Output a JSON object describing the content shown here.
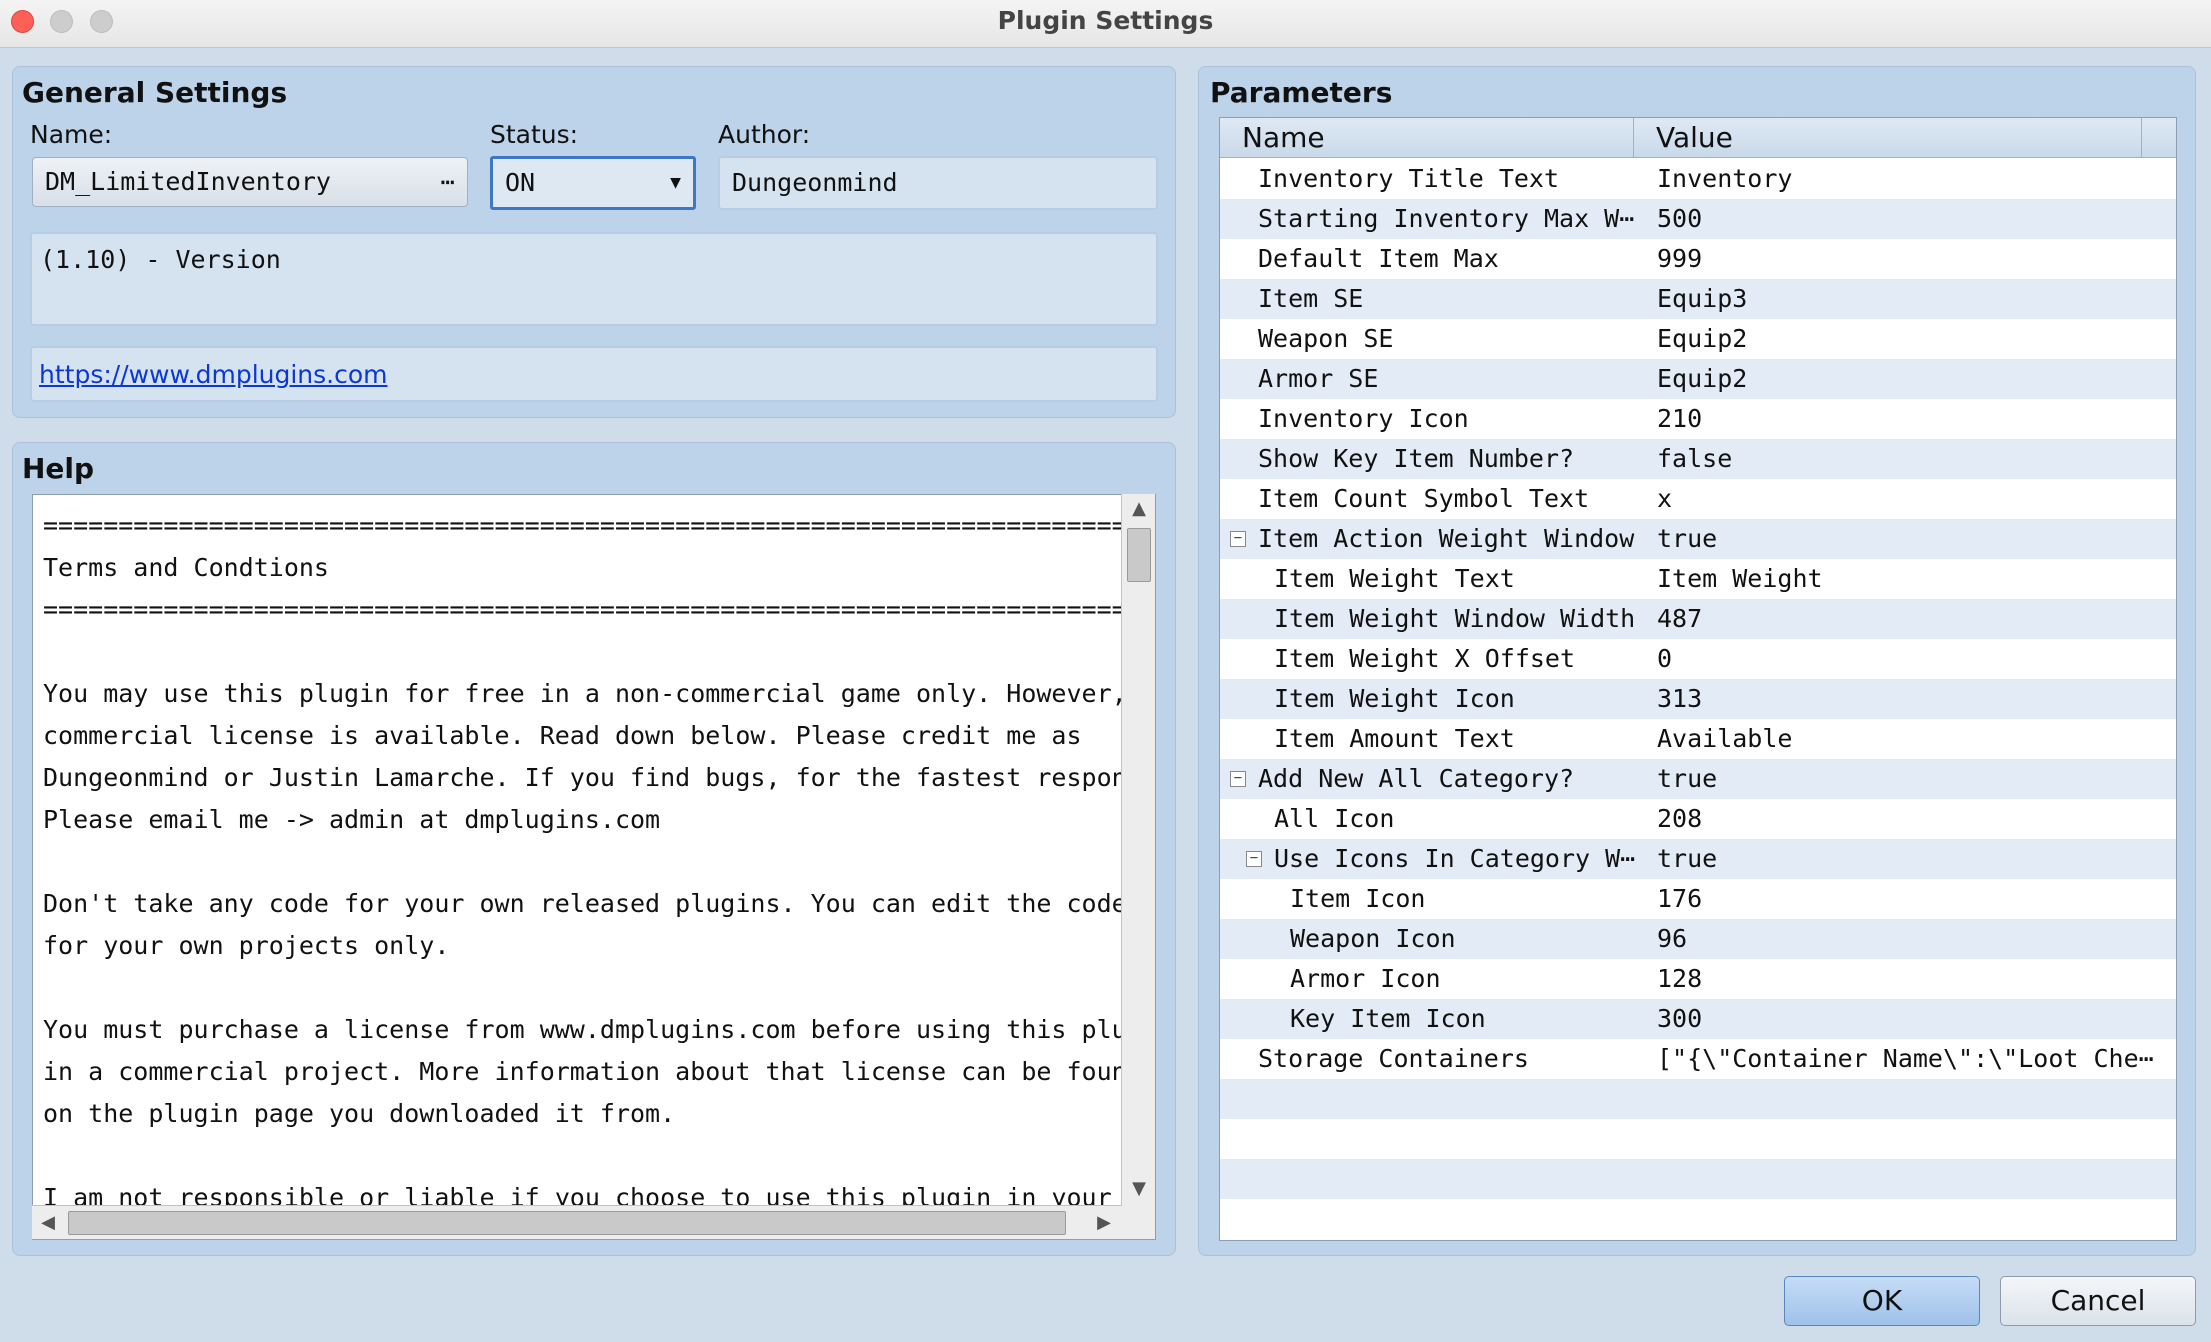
{
  "window": {
    "title": "Plugin Settings"
  },
  "general": {
    "title": "General Settings",
    "name_label": "Name:",
    "name_value": "DM_LimitedInventory",
    "name_browse": "⋯",
    "status_label": "Status:",
    "status_value": "ON",
    "author_label": "Author:",
    "author_value": "Dungeonmind",
    "description": "(1.10) - Version",
    "url": "https://www.dmplugins.com"
  },
  "help": {
    "title": "Help",
    "lines": [
      "============================================================================",
      "Terms and Condtions",
      "============================================================================",
      "",
      "You may use this plugin for free in a non-commercial game only. However,",
      "commercial license is available. Read down below. Please credit me as",
      "Dungeonmind or Justin Lamarche. If you find bugs, for the fastest respone",
      "Please email me -> admin at dmplugins.com",
      "",
      "Don't take any code for your own released plugins. You can edit the code",
      "for your own projects only.",
      "",
      "You must purchase a license from www.dmplugins.com before using this plugin",
      "in a commercial project. More information about that license can be found",
      "on the plugin page you downloaded it from.",
      "",
      "I am not responsible or liable if you choose to use this plugin in your"
    ]
  },
  "parameters": {
    "title": "Parameters",
    "col_name": "Name",
    "col_value": "Value",
    "rows": [
      {
        "name": "Inventory Title Text",
        "value": "Inventory",
        "level": 0,
        "toggle": false
      },
      {
        "name": "Starting Inventory Max W⋯",
        "value": "500",
        "level": 0,
        "toggle": false
      },
      {
        "name": "Default Item Max",
        "value": "999",
        "level": 0,
        "toggle": false
      },
      {
        "name": "Item SE",
        "value": "Equip3",
        "level": 0,
        "toggle": false
      },
      {
        "name": "Weapon SE",
        "value": "Equip2",
        "level": 0,
        "toggle": false
      },
      {
        "name": "Armor SE",
        "value": "Equip2",
        "level": 0,
        "toggle": false
      },
      {
        "name": "Inventory Icon",
        "value": "210",
        "level": 0,
        "toggle": false
      },
      {
        "name": "Show Key Item Number?",
        "value": "false",
        "level": 0,
        "toggle": false
      },
      {
        "name": "Item Count Symbol Text",
        "value": "x",
        "level": 0,
        "toggle": false
      },
      {
        "name": "Item Action Weight Window",
        "value": "true",
        "level": 0,
        "toggle": true
      },
      {
        "name": "Item Weight Text",
        "value": "Item Weight",
        "level": 1,
        "toggle": false
      },
      {
        "name": "Item Weight Window Width",
        "value": "487",
        "level": 1,
        "toggle": false
      },
      {
        "name": "Item Weight X Offset",
        "value": "0",
        "level": 1,
        "toggle": false
      },
      {
        "name": "Item Weight Icon",
        "value": "313",
        "level": 1,
        "toggle": false
      },
      {
        "name": "Item Amount Text",
        "value": "Available",
        "level": 1,
        "toggle": false
      },
      {
        "name": "Add New All Category?",
        "value": "true",
        "level": 0,
        "toggle": true
      },
      {
        "name": "All Icon",
        "value": "208",
        "level": 1,
        "toggle": false
      },
      {
        "name": "Use Icons In Category W⋯",
        "value": "true",
        "level": 1,
        "toggle": true
      },
      {
        "name": "Item Icon",
        "value": "176",
        "level": 2,
        "toggle": false
      },
      {
        "name": "Weapon Icon",
        "value": "96",
        "level": 2,
        "toggle": false
      },
      {
        "name": "Armor Icon",
        "value": "128",
        "level": 2,
        "toggle": false
      },
      {
        "name": "Key Item Icon",
        "value": "300",
        "level": 2,
        "toggle": false
      },
      {
        "name": "Storage Containers",
        "value": "[\"{\\\"Container Name\\\":\\\"Loot Che⋯",
        "level": 0,
        "toggle": false
      },
      {
        "name": "",
        "value": "",
        "level": 0,
        "toggle": false
      },
      {
        "name": "",
        "value": "",
        "level": 0,
        "toggle": false
      },
      {
        "name": "",
        "value": "",
        "level": 0,
        "toggle": false
      }
    ]
  },
  "buttons": {
    "ok": "OK",
    "cancel": "Cancel"
  },
  "colors": {
    "panel": "#bcd3ea",
    "background": "#cfdcea",
    "accent": "#3e78c4",
    "link": "#0b37d6"
  }
}
